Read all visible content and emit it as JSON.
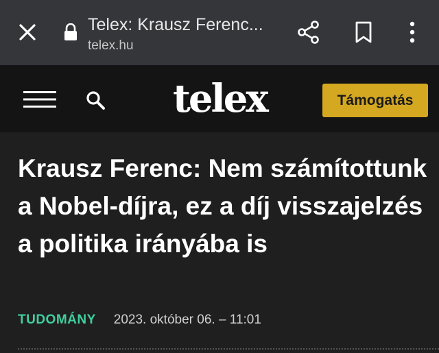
{
  "browser": {
    "title": "Telex: Krausz Ferenc...",
    "url": "telex.hu",
    "icons": {
      "close": "close-icon",
      "lock": "lock-icon",
      "share": "share-icon",
      "bookmark": "bookmark-icon",
      "more": "more-vert-icon"
    }
  },
  "header": {
    "logo": "telex",
    "support_label": "Támogatás",
    "icons": {
      "menu": "hamburger-menu-icon",
      "search": "search-icon"
    }
  },
  "article": {
    "headline": "Krausz Ferenc: Nem számítottunk a Nobel-díjra, ez a díj visszajelzés a politika irányába is",
    "category": "TUDOMÁNY",
    "date": "2023. október 06. – 11:01"
  },
  "colors": {
    "chrome_bg": "#35363a",
    "header_bg": "#141414",
    "page_bg": "#1f1f1f",
    "accent_button": "#d4a820",
    "category": "#3fcfa0"
  }
}
